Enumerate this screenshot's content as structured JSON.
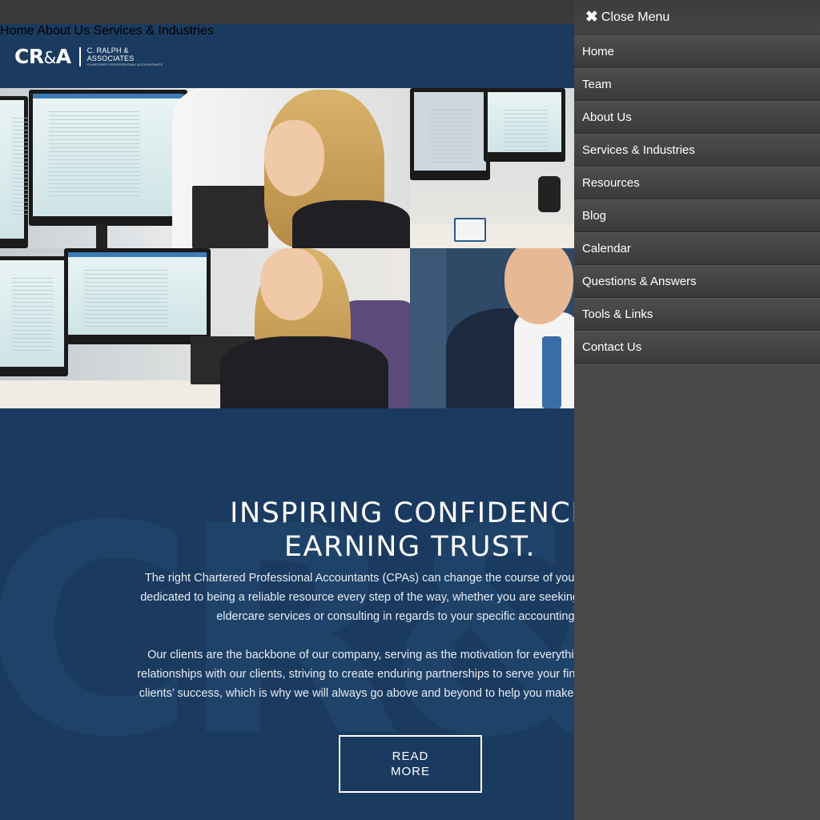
{
  "logo": {
    "mark_left": "CR",
    "mark_amp": "&",
    "mark_right": "A",
    "name_line1": "C. RALPH &",
    "name_line2": "ASSOCIATES",
    "tagline": "CHARTERED PROFESSIONAL ACCOUNTANTS"
  },
  "nav": {
    "home": "Home",
    "about": "About Us",
    "services": "Services & Industries"
  },
  "hero": {
    "watermark": "CR&",
    "headline_line1": "INSPIRING CONFIDENCE",
    "headline_line2": "EARNING TRUST.",
    "para1_line1": "The right Chartered Professional Accountants (CPAs) can change the course of your business – and yo",
    "para1_line2": "dedicated to being a reliable resource every step of the way, whether you are seeking assistance for your",
    "para1_line3": "eldercare services or consulting in regards to your specific accounting and t",
    "para2_line1": "Our clients are the backbone of our company, serving as the motivation for everything we are able to a",
    "para2_line2": "relationships with our clients, striving to create enduring partnerships to serve your financial needs. We bel",
    "para2_line3": "clients’ success, which is why we will always go above and beyond to help you make the right choices, no",
    "read_more_line1": "READ",
    "read_more_line2": "MORE"
  },
  "menu": {
    "close_icon": "✖",
    "close_label": "Close Menu",
    "items": [
      {
        "label": "Home"
      },
      {
        "label": "Team"
      },
      {
        "label": "About Us"
      },
      {
        "label": "Services & Industries"
      },
      {
        "label": "Resources"
      },
      {
        "label": "Blog"
      },
      {
        "label": "Calendar"
      },
      {
        "label": "Questions & Answers"
      },
      {
        "label": "Tools & Links"
      },
      {
        "label": "Contact Us"
      }
    ]
  },
  "colors": {
    "header_bg": "#1b3a5f",
    "menu_bg": "#484848",
    "topbar_bg": "#3a3a3a"
  }
}
